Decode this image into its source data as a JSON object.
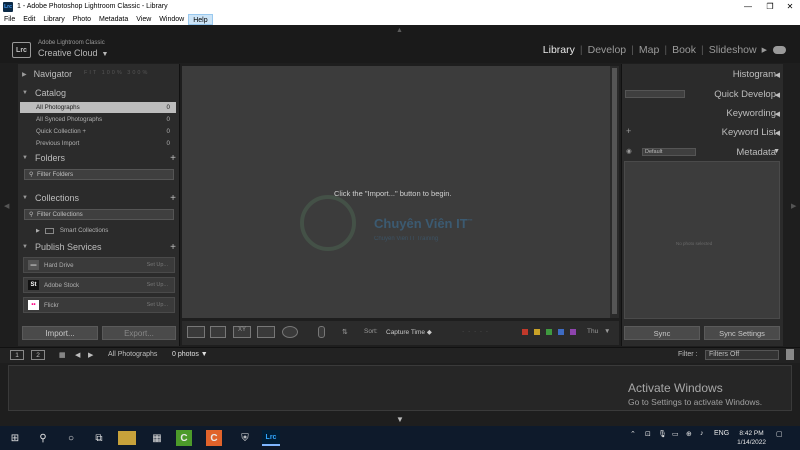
{
  "window": {
    "title": "1 - Adobe Photoshop Lightroom Classic - Library",
    "minimize_glyph": "—",
    "maximize_glyph": "❐",
    "close_glyph": "✕"
  },
  "menubar": {
    "items": [
      "File",
      "Edit",
      "Library",
      "Photo",
      "Metadata",
      "View",
      "Window",
      "Help"
    ]
  },
  "identity": {
    "logo": "Lrc",
    "line1": "Adobe Lightroom Classic",
    "line2": "Creative Cloud",
    "caret": "▼"
  },
  "modules": {
    "items": [
      "Library",
      "Develop",
      "Map",
      "Book",
      "Slideshow"
    ],
    "active": "Library",
    "more": "▶"
  },
  "left_panel": {
    "navigator": {
      "title": "Navigator",
      "zoom": "FIT  100%  300%"
    },
    "catalog": {
      "title": "Catalog",
      "rows": [
        {
          "label": "All Photographs",
          "count": "0"
        },
        {
          "label": "All Synced Photographs",
          "count": "0"
        },
        {
          "label": "Quick Collection +",
          "count": "0"
        },
        {
          "label": "Previous Import",
          "count": "0"
        }
      ]
    },
    "folders": {
      "title": "Folders",
      "filter": "Filter Folders"
    },
    "collections": {
      "title": "Collections",
      "filter": "Filter Collections",
      "smart": "Smart Collections"
    },
    "publish": {
      "title": "Publish Services",
      "services": [
        {
          "name": "Hard Drive",
          "setup": "Set Up...",
          "icon": "▬",
          "icon_color": "#9a9a9a",
          "icon_bg": "#555"
        },
        {
          "name": "Adobe Stock",
          "setup": "Set Up...",
          "icon": "St",
          "icon_color": "#ffffff",
          "icon_bg": "#111"
        },
        {
          "name": "Flickr",
          "setup": "Set Up...",
          "icon": "••",
          "icon_color": "#ff0084",
          "icon_bg": "#ffffff"
        }
      ]
    },
    "import_btn": "Import...",
    "export_btn": "Export..."
  },
  "center": {
    "message": "Click the \"Import...\" button to begin.",
    "watermark": "Chuyên Viên IT",
    "watermark_tm": "™",
    "watermark_sub": "Chuyên Viên IT Training"
  },
  "toolbar": {
    "sort_label": "Sort:",
    "sort_value": "Capture Time",
    "thumb_label": "Thu",
    "flag_colors": [
      "#c0392b",
      "#c9a227",
      "#3f9a3f",
      "#3e6bc2",
      "#8e44ad"
    ]
  },
  "right_panel": {
    "histogram": "Histogram",
    "quick_develop": "Quick Develop",
    "keywording": "Keywording",
    "keyword_list": "Keyword List",
    "metadata": "Metadata",
    "metadata_preset": "Default",
    "no_photo": "No photo selected",
    "sync_btn": "Sync",
    "sync_settings_btn": "Sync Settings"
  },
  "filmstrip_bar": {
    "view1": "1",
    "view2": "2",
    "source": "All Photographs",
    "count": "0 photos",
    "filter_label": "Filter :",
    "filter_value": "Filters Off"
  },
  "activate": {
    "title": "Activate Windows",
    "subtitle": "Go to Settings to activate Windows."
  },
  "taskbar": {
    "lang": "ENG",
    "time": "8:42 PM",
    "date": "1/14/2022"
  }
}
